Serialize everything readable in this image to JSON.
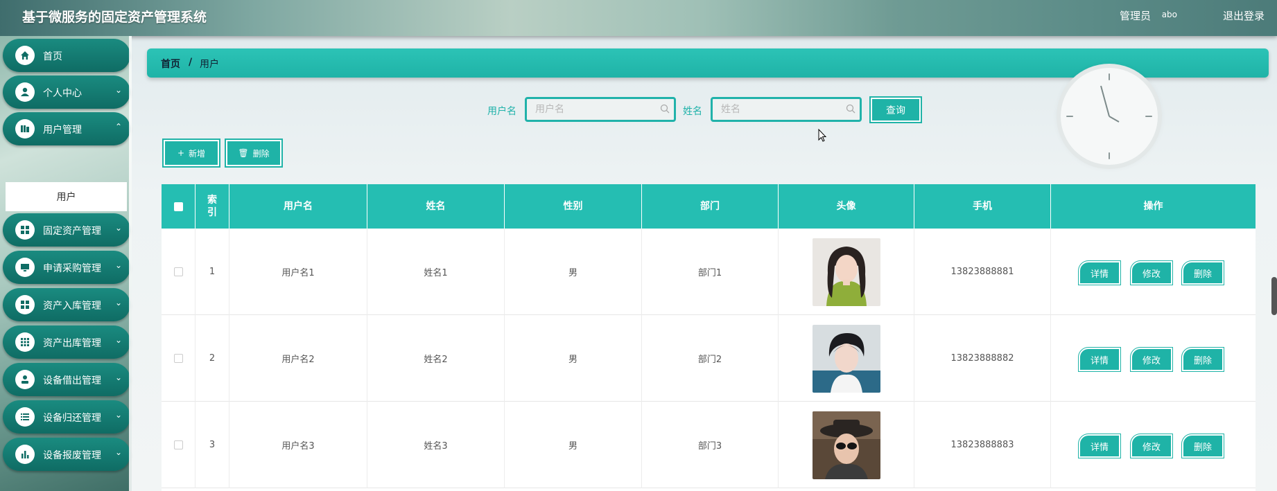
{
  "header": {
    "title": "基于微服务的固定资产管理系统",
    "role": "管理员",
    "username": "abo",
    "logout": "退出登录"
  },
  "sidebar": {
    "items": [
      {
        "label": "首页",
        "icon": "home-icon"
      },
      {
        "label": "个人中心",
        "icon": "user-icon"
      },
      {
        "label": "用户管理",
        "icon": "folder-icon"
      },
      {
        "label": "固定资产管理",
        "icon": "grid-icon"
      },
      {
        "label": "申请采购管理",
        "icon": "monitor-icon"
      },
      {
        "label": "资产入库管理",
        "icon": "grid-icon"
      },
      {
        "label": "资产出库管理",
        "icon": "apps-icon"
      },
      {
        "label": "设备借出管理",
        "icon": "person-icon"
      },
      {
        "label": "设备归还管理",
        "icon": "list-icon"
      },
      {
        "label": "设备报废管理",
        "icon": "chart-icon"
      }
    ],
    "active_sub": "用户"
  },
  "breadcrumb": {
    "home": "首页",
    "separator": "/",
    "current": "用户"
  },
  "search": {
    "username_label": "用户名",
    "username_placeholder": "用户名",
    "name_label": "姓名",
    "name_placeholder": "姓名",
    "query_button": "查询"
  },
  "toolbar": {
    "add": "新增",
    "delete": "删除"
  },
  "table": {
    "columns": [
      "索引",
      "用户名",
      "姓名",
      "性别",
      "部门",
      "头像",
      "手机",
      "操作"
    ],
    "index_col_line1": "索",
    "index_col_line2": "引",
    "rows": [
      {
        "index": "1",
        "username": "用户名1",
        "name": "姓名1",
        "gender": "男",
        "dept": "部门1",
        "phone": "13823888881"
      },
      {
        "index": "2",
        "username": "用户名2",
        "name": "姓名2",
        "gender": "男",
        "dept": "部门2",
        "phone": "13823888882"
      },
      {
        "index": "3",
        "username": "用户名3",
        "name": "姓名3",
        "gender": "男",
        "dept": "部门3",
        "phone": "13823888883"
      }
    ],
    "actions": {
      "detail": "详情",
      "edit": "修改",
      "delete": "删除"
    }
  },
  "colors": {
    "accent": "#1fb3a7",
    "header_teal": "#25beb2",
    "menu_teal": "#0f6c64"
  }
}
